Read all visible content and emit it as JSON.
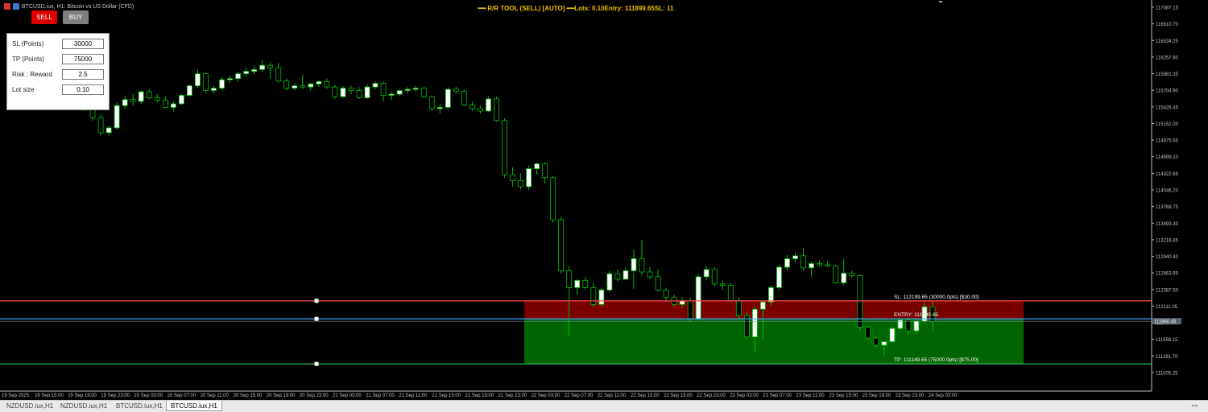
{
  "window": {
    "symbol_title": "BTCUSD.iux, H1:  Bitcoin vs US Dollar (CFD)"
  },
  "buttons": {
    "sell_label": "SELL",
    "buy_label": "BUY",
    "sell_color": "#e00000",
    "buy_color": "#808080"
  },
  "header": {
    "rr_tool": "R/R TOOL (SELL) [AUTO]",
    "lots_info": "Lots: 0.10Entry: 111899.65SL: 11",
    "color": "#e6c200"
  },
  "panel": {
    "sl_label": "SL (Points)",
    "sl_value": "30000",
    "tp_label": "TP (Points)",
    "tp_value": "75000",
    "rr_label": "Risk : Reward",
    "rr_value": "2.5",
    "lot_label": "Lot size",
    "lot_value": "0.10"
  },
  "levels": {
    "sl_label": "SL: 112199.65 (30000.0pts) [$30.00]",
    "entry_label": "ENTRY: 111899.65",
    "tp_label": "TP: 111149.65 (75000.0pts) [$75.00]",
    "current_price": "111860.45",
    "sl_price": 112199.65,
    "entry_price": 111899.65,
    "tp_price": 111149.65,
    "current_price_value": 111860.45,
    "sl_color": "#ff5050",
    "entry_color": "#4aa6ff",
    "tp_color": "#30c060",
    "risk_zone_color": "#7a0000",
    "reward_zone_color": "#006400"
  },
  "price_axis": {
    "ticks": [
      "117087.15",
      "116810.70",
      "116534.25",
      "116257.80",
      "115981.35",
      "115704.90",
      "115428.45",
      "115152.00",
      "114875.55",
      "114599.10",
      "114322.65",
      "114046.20",
      "113769.75",
      "113493.30",
      "113216.85",
      "112940.40",
      "112663.95",
      "112387.50",
      "112111.05",
      "111834.60",
      "111558.15",
      "111281.70",
      "111005.25"
    ],
    "max": 117087.15,
    "min": 111005.25
  },
  "time_axis": {
    "ticks": [
      "19 Sep 2025",
      "19 Sep 15:00",
      "19 Sep 19:00",
      "19 Sep 23:00",
      "20 Sep 03:00",
      "20 Sep 07:00",
      "20 Sep 11:00",
      "20 Sep 15:00",
      "20 Sep 19:00",
      "20 Sep 23:00",
      "21 Sep 03:00",
      "21 Sep 07:00",
      "21 Sep 11:00",
      "21 Sep 15:00",
      "21 Sep 19:00",
      "21 Sep 23:00",
      "22 Sep 03:00",
      "22 Sep 07:00",
      "22 Sep 11:00",
      "22 Sep 15:00",
      "22 Sep 19:00",
      "22 Sep 23:00",
      "23 Sep 03:00",
      "23 Sep 07:00",
      "23 Sep 11:00",
      "23 Sep 15:00",
      "23 Sep 19:00",
      "23 Sep 23:00",
      "24 Sep 03:00"
    ]
  },
  "tabs": [
    "NZDUSD.iux,H1",
    "NZDUSD.iux,H1",
    "BTCUSD.iux,H1",
    "BTCUSD.iux,H1"
  ],
  "active_tab": 3,
  "chart_data": {
    "type": "candlestick",
    "interval": "H1",
    "candle_colors": {
      "bull": "#ffffff",
      "bear": "#000000",
      "wick": "#00c000"
    },
    "candles": [
      {
        "o": 115500,
        "h": 115600,
        "l": 115380,
        "c": 115450
      },
      {
        "o": 115450,
        "h": 115520,
        "l": 115360,
        "c": 115400
      },
      {
        "o": 115400,
        "h": 115480,
        "l": 115200,
        "c": 115250
      },
      {
        "o": 115250,
        "h": 115300,
        "l": 114950,
        "c": 115000
      },
      {
        "o": 115000,
        "h": 115120,
        "l": 114950,
        "c": 115080
      },
      {
        "o": 115080,
        "h": 115500,
        "l": 115050,
        "c": 115450
      },
      {
        "o": 115450,
        "h": 115620,
        "l": 115400,
        "c": 115550
      },
      {
        "o": 115550,
        "h": 115650,
        "l": 115450,
        "c": 115520
      },
      {
        "o": 115520,
        "h": 115700,
        "l": 115480,
        "c": 115680
      },
      {
        "o": 115680,
        "h": 115730,
        "l": 115550,
        "c": 115580
      },
      {
        "o": 115580,
        "h": 115640,
        "l": 115500,
        "c": 115540
      },
      {
        "o": 115540,
        "h": 115600,
        "l": 115400,
        "c": 115420
      },
      {
        "o": 115420,
        "h": 115520,
        "l": 115350,
        "c": 115480
      },
      {
        "o": 115480,
        "h": 115650,
        "l": 115460,
        "c": 115620
      },
      {
        "o": 115620,
        "h": 115800,
        "l": 115600,
        "c": 115780
      },
      {
        "o": 115780,
        "h": 116050,
        "l": 115750,
        "c": 115980
      },
      {
        "o": 115980,
        "h": 116000,
        "l": 115660,
        "c": 115700
      },
      {
        "o": 115700,
        "h": 115780,
        "l": 115650,
        "c": 115740
      },
      {
        "o": 115740,
        "h": 115920,
        "l": 115700,
        "c": 115880
      },
      {
        "o": 115880,
        "h": 115950,
        "l": 115820,
        "c": 115900
      },
      {
        "o": 115900,
        "h": 116000,
        "l": 115850,
        "c": 115980
      },
      {
        "o": 115980,
        "h": 116080,
        "l": 115930,
        "c": 116020
      },
      {
        "o": 116020,
        "h": 116120,
        "l": 115970,
        "c": 116050
      },
      {
        "o": 116050,
        "h": 116200,
        "l": 116000,
        "c": 116120
      },
      {
        "o": 116120,
        "h": 116180,
        "l": 115900,
        "c": 116080
      },
      {
        "o": 116080,
        "h": 116160,
        "l": 115820,
        "c": 115860
      },
      {
        "o": 115860,
        "h": 115900,
        "l": 115700,
        "c": 115740
      },
      {
        "o": 115740,
        "h": 115820,
        "l": 115700,
        "c": 115780
      },
      {
        "o": 115780,
        "h": 115960,
        "l": 115720,
        "c": 115760
      },
      {
        "o": 115760,
        "h": 115830,
        "l": 115700,
        "c": 115810
      },
      {
        "o": 115810,
        "h": 115870,
        "l": 115760,
        "c": 115850
      },
      {
        "o": 115850,
        "h": 115900,
        "l": 115730,
        "c": 115760
      },
      {
        "o": 115760,
        "h": 115800,
        "l": 115560,
        "c": 115600
      },
      {
        "o": 115600,
        "h": 115780,
        "l": 115580,
        "c": 115740
      },
      {
        "o": 115740,
        "h": 115780,
        "l": 115640,
        "c": 115700
      },
      {
        "o": 115700,
        "h": 115760,
        "l": 115560,
        "c": 115580
      },
      {
        "o": 115580,
        "h": 115800,
        "l": 115560,
        "c": 115760
      },
      {
        "o": 115760,
        "h": 115860,
        "l": 115720,
        "c": 115820
      },
      {
        "o": 115820,
        "h": 115850,
        "l": 115520,
        "c": 115620
      },
      {
        "o": 115620,
        "h": 115680,
        "l": 115540,
        "c": 115640
      },
      {
        "o": 115640,
        "h": 115720,
        "l": 115600,
        "c": 115700
      },
      {
        "o": 115700,
        "h": 115760,
        "l": 115650,
        "c": 115720
      },
      {
        "o": 115720,
        "h": 115780,
        "l": 115680,
        "c": 115740
      },
      {
        "o": 115740,
        "h": 115760,
        "l": 115580,
        "c": 115600
      },
      {
        "o": 115600,
        "h": 115620,
        "l": 115360,
        "c": 115400
      },
      {
        "o": 115400,
        "h": 115480,
        "l": 115320,
        "c": 115420
      },
      {
        "o": 115420,
        "h": 115760,
        "l": 115380,
        "c": 115720
      },
      {
        "o": 115720,
        "h": 115760,
        "l": 115650,
        "c": 115690
      },
      {
        "o": 115690,
        "h": 115720,
        "l": 115440,
        "c": 115460
      },
      {
        "o": 115460,
        "h": 115520,
        "l": 115360,
        "c": 115400
      },
      {
        "o": 115400,
        "h": 115450,
        "l": 115320,
        "c": 115360
      },
      {
        "o": 115360,
        "h": 115600,
        "l": 115340,
        "c": 115560
      },
      {
        "o": 115560,
        "h": 115600,
        "l": 115180,
        "c": 115200
      },
      {
        "o": 115200,
        "h": 115240,
        "l": 114250,
        "c": 114300
      },
      {
        "o": 114300,
        "h": 114420,
        "l": 114100,
        "c": 114200
      },
      {
        "o": 114200,
        "h": 114320,
        "l": 114050,
        "c": 114100
      },
      {
        "o": 114100,
        "h": 114450,
        "l": 114050,
        "c": 114400
      },
      {
        "o": 114400,
        "h": 114500,
        "l": 114300,
        "c": 114480
      },
      {
        "o": 114480,
        "h": 114500,
        "l": 114150,
        "c": 114250
      },
      {
        "o": 114250,
        "h": 114280,
        "l": 113500,
        "c": 113550
      },
      {
        "o": 113550,
        "h": 113600,
        "l": 112650,
        "c": 112700
      },
      {
        "o": 112700,
        "h": 112780,
        "l": 111600,
        "c": 112420
      },
      {
        "o": 112420,
        "h": 112560,
        "l": 112300,
        "c": 112540
      },
      {
        "o": 112540,
        "h": 112600,
        "l": 112380,
        "c": 112420
      },
      {
        "o": 112420,
        "h": 112500,
        "l": 112100,
        "c": 112140
      },
      {
        "o": 112140,
        "h": 112420,
        "l": 112100,
        "c": 112380
      },
      {
        "o": 112380,
        "h": 112700,
        "l": 112350,
        "c": 112650
      },
      {
        "o": 112650,
        "h": 112720,
        "l": 112520,
        "c": 112560
      },
      {
        "o": 112560,
        "h": 112760,
        "l": 112540,
        "c": 112700
      },
      {
        "o": 112700,
        "h": 113050,
        "l": 112400,
        "c": 112900
      },
      {
        "o": 112900,
        "h": 113220,
        "l": 112620,
        "c": 112680
      },
      {
        "o": 112680,
        "h": 112760,
        "l": 112560,
        "c": 112600
      },
      {
        "o": 112600,
        "h": 112720,
        "l": 112350,
        "c": 112380
      },
      {
        "o": 112380,
        "h": 112420,
        "l": 112200,
        "c": 112260
      },
      {
        "o": 112260,
        "h": 112300,
        "l": 112100,
        "c": 112140
      },
      {
        "o": 112140,
        "h": 112260,
        "l": 112080,
        "c": 112200
      },
      {
        "o": 112200,
        "h": 112260,
        "l": 111850,
        "c": 111900
      },
      {
        "o": 111900,
        "h": 112650,
        "l": 111860,
        "c": 112600
      },
      {
        "o": 112600,
        "h": 112780,
        "l": 112550,
        "c": 112720
      },
      {
        "o": 112720,
        "h": 112760,
        "l": 112440,
        "c": 112480
      },
      {
        "o": 112480,
        "h": 112540,
        "l": 112380,
        "c": 112460
      },
      {
        "o": 112460,
        "h": 112500,
        "l": 112180,
        "c": 112200
      },
      {
        "o": 112200,
        "h": 112260,
        "l": 111900,
        "c": 111950
      },
      {
        "o": 111950,
        "h": 112000,
        "l": 111560,
        "c": 111600
      },
      {
        "o": 111600,
        "h": 112100,
        "l": 111350,
        "c": 112060
      },
      {
        "o": 112060,
        "h": 112120,
        "l": 111560,
        "c": 112180
      },
      {
        "o": 112180,
        "h": 112460,
        "l": 112120,
        "c": 112420
      },
      {
        "o": 112420,
        "h": 112800,
        "l": 112380,
        "c": 112760
      },
      {
        "o": 112760,
        "h": 112960,
        "l": 112700,
        "c": 112900
      },
      {
        "o": 112900,
        "h": 113000,
        "l": 112840,
        "c": 112950
      },
      {
        "o": 112950,
        "h": 113080,
        "l": 112700,
        "c": 112750
      },
      {
        "o": 112750,
        "h": 112860,
        "l": 112600,
        "c": 112820
      },
      {
        "o": 112820,
        "h": 112880,
        "l": 112760,
        "c": 112800
      },
      {
        "o": 112800,
        "h": 112860,
        "l": 112760,
        "c": 112780
      },
      {
        "o": 112780,
        "h": 112800,
        "l": 112480,
        "c": 112500
      },
      {
        "o": 112500,
        "h": 112900,
        "l": 112460,
        "c": 112660
      },
      {
        "o": 112660,
        "h": 112700,
        "l": 112580,
        "c": 112620
      },
      {
        "o": 112620,
        "h": 112640,
        "l": 111700,
        "c": 111760
      },
      {
        "o": 111760,
        "h": 111780,
        "l": 111540,
        "c": 111580
      },
      {
        "o": 111580,
        "h": 111620,
        "l": 111420,
        "c": 111460
      },
      {
        "o": 111460,
        "h": 111500,
        "l": 111300,
        "c": 111520
      },
      {
        "o": 111520,
        "h": 111760,
        "l": 111500,
        "c": 111740
      },
      {
        "o": 111740,
        "h": 111900,
        "l": 111720,
        "c": 111880
      },
      {
        "o": 111880,
        "h": 111920,
        "l": 111640,
        "c": 111700
      },
      {
        "o": 111700,
        "h": 111900,
        "l": 111650,
        "c": 111860
      },
      {
        "o": 111860,
        "h": 112180,
        "l": 111820,
        "c": 112100
      },
      {
        "o": 112100,
        "h": 112200,
        "l": 111700,
        "c": 111860
      }
    ]
  }
}
